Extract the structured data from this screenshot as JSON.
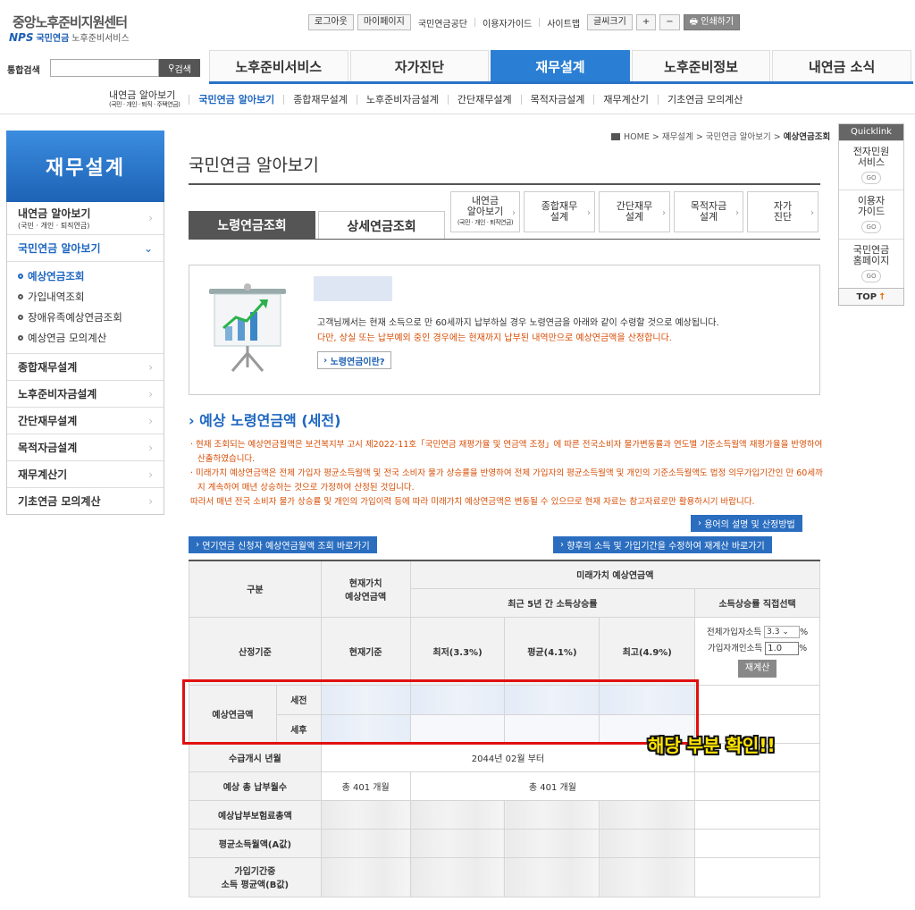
{
  "header": {
    "logo_title": "중앙노후준비지원센터",
    "logo_nps": "NPS",
    "logo_org": "국민연금",
    "logo_sub": "노후준비서비스",
    "logout": "로그아웃",
    "mypage": "마이페이지",
    "nps_link": "국민연금공단",
    "guide": "이용자가이드",
    "sitemap": "사이트맵",
    "fontsize": "글씨크기",
    "plus": "+",
    "minus": "−",
    "print": "인쇄하기",
    "search_label": "통합검색",
    "search_button": "검색"
  },
  "gnb": [
    "노후준비서비스",
    "자가진단",
    "재무설계",
    "노후준비정보",
    "내연금 소식"
  ],
  "snb": {
    "first": "내연금 알아보기",
    "first_sub": "(국민 · 개인 · 퇴직 · 주택연금)",
    "items": [
      "국민연금 알아보기",
      "종합재무설계",
      "노후준비자금설계",
      "간단재무설계",
      "목적자금설계",
      "재무계산기",
      "기초연금 모의계산"
    ]
  },
  "lnb": {
    "title": "재무설계",
    "item1": "내연금 알아보기",
    "item1_sub": "(국민 · 개인 · 퇴직연금)",
    "item2": "국민연금 알아보기",
    "subs": [
      "예상연금조회",
      "가입내역조회",
      "장애유족예상연금조회",
      "예상연금 모의계산"
    ],
    "items": [
      "종합재무설계",
      "노후준비자금설계",
      "간단재무설계",
      "목적자금설계",
      "재무계산기",
      "기초연금 모의계산"
    ]
  },
  "quicklink": {
    "title": "Quicklink",
    "items": [
      [
        "전자민원",
        "서비스"
      ],
      [
        "이용자",
        "가이드"
      ],
      [
        "국민연금",
        "홈페이지"
      ]
    ],
    "go": "GO",
    "top": "TOP"
  },
  "breadcrumb": {
    "home": "HOME",
    "a": "재무설계",
    "b": "국민연금 알아보기",
    "c": "예상연금조회"
  },
  "page_title": "국민연금 알아보기",
  "tabs": [
    "노령연금조회",
    "상세연금조회"
  ],
  "shortcuts": [
    {
      "label": "내연금",
      "label2": "알아보기",
      "sub": "(국민 · 개인 · 퇴직연금)"
    },
    {
      "label": "종합재무",
      "label2": "설계"
    },
    {
      "label": "간단재무",
      "label2": "설계"
    },
    {
      "label": "목적자금",
      "label2": "설계"
    },
    {
      "label": "자가",
      "label2": "진단"
    }
  ],
  "info": {
    "line1": "고객님께서는 현재 소득으로 만 60세까지 납부하실 경우 노령연금을 아래와 같이 수령할 것으로 예상됩니다.",
    "line2": "다만, 상실 또는 납부예외 중인 경우에는 현재까지 납부된 내역만으로 예상연금액을 산정합니다.",
    "button": "노령연금이란?"
  },
  "section_title": "예상 노령연금액 (세전)",
  "notes": [
    "· 현재 조회되는 예상연금월액은 보건복지부 고시 제2022-11호「국민연금 재평가율 및 연금액 조정」에 따른 전국소비자 물가변동률과 연도별 기준소득월액 재평가율을 반영하여 산출하였습니다.",
    "· 미래가치 예상연금액은 전체 가입자 평균소득월액 및 전국 소비자 물가 상승률을 반영하여 전체 가입자의 평균소득월액 및 개인의 기준소득월액도 법정 의무가입기간인 만 60세까지 계속하여 매년 상승하는 것으로 가정하여 산정된 것입니다.",
    "따라서 매년 전국 소비자 물가 상승률 및 개인의 가입이력 등에 따라 미래가치 예상연금액은 변동될 수 있으므로 현재 자료는 참고자료로만 활용하시기 바랍니다."
  ],
  "buttons": {
    "terms": "용어의 설명 및 산정방법",
    "postpone": "연기연금 신청자 예상연금월액 조회 바로가기",
    "recalc_link": "향후의 소득 및 가입기간을 수정하여 재계산 바로가기"
  },
  "table": {
    "h_category": "구분",
    "h_current": "현재가치",
    "h_current2": "예상연금액",
    "h_future": "미래가치 예상연금액",
    "h_recent": "최근 5년 간 소득상승률",
    "h_direct": "소득상승률 직접선택",
    "basis": "산정기준",
    "current_basis": "현재기준",
    "min": "최저(3.3%)",
    "avg": "평균(4.1%)",
    "max": "최고(4.9%)",
    "all_income_label": "전체가입자소득",
    "all_income_value": "3.3",
    "personal_income_label": "가입자개인소득",
    "personal_income_value": "1.0",
    "percent": "%",
    "recalc": "재계산",
    "pension": "예상연금액",
    "pre_tax": "세전",
    "post_tax": "세후",
    "start_label": "수급개시 년월",
    "start_value": "2044년 02월 부터",
    "months_label": "예상 총 납부월수",
    "months_current": "총 401 개월",
    "months_future": "총 401 개월",
    "premium_label": "예상납부보험료총액",
    "avg_income_label": "평균소득월액(A값)",
    "period_label": "가입기간중",
    "period_label2": "소득 평균액(B값)"
  },
  "annotation": "해당 부분 확인!!"
}
